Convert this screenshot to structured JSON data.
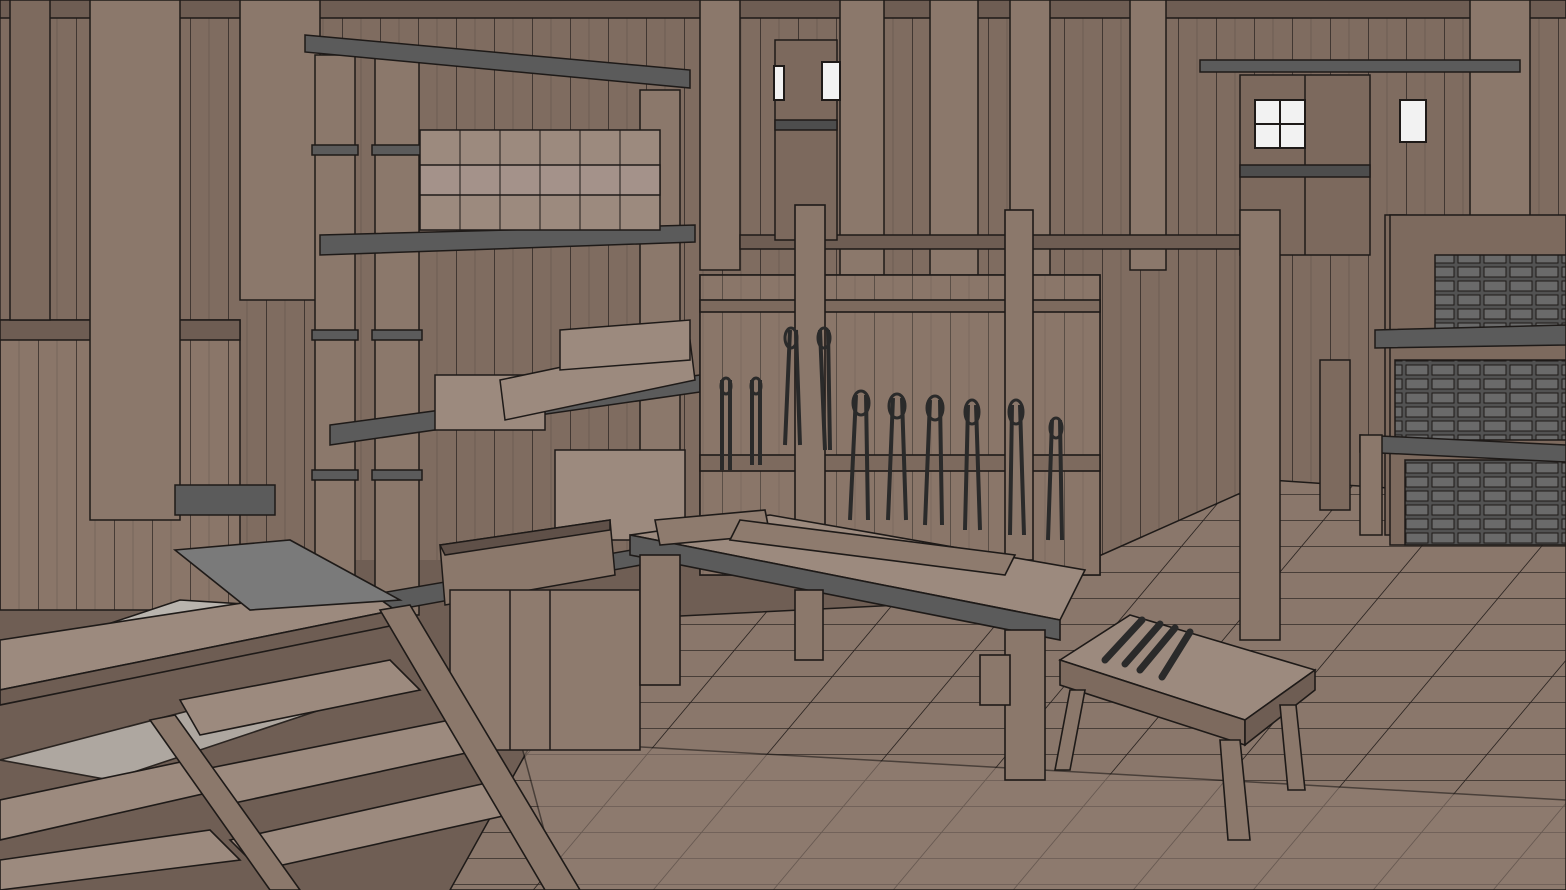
{
  "scene": {
    "name": "blacksmith-workshop-interior",
    "style": "outlined-3d-render",
    "palette": {
      "wood_light": "#9c8a7e",
      "wood_mid": "#857264",
      "wood_dark": "#5f5048",
      "floor": "#8a776b",
      "iron": "#5b5b5b",
      "iron_dark": "#3a3a3a",
      "outline": "#1e1a18",
      "stone": "#b9b4ae",
      "window_light": "#f2f2f2"
    },
    "objects": [
      "back-wall-planks",
      "ceiling-beams",
      "rear-doors",
      "upper-windows",
      "support-pillars",
      "storage-shelf-with-lumber",
      "tong-rack",
      "workbench",
      "small-stool-with-chisels",
      "ingot-shelf",
      "wooden-staircase",
      "plank-floor"
    ],
    "tong_count": 10,
    "chisel_count": 4
  }
}
